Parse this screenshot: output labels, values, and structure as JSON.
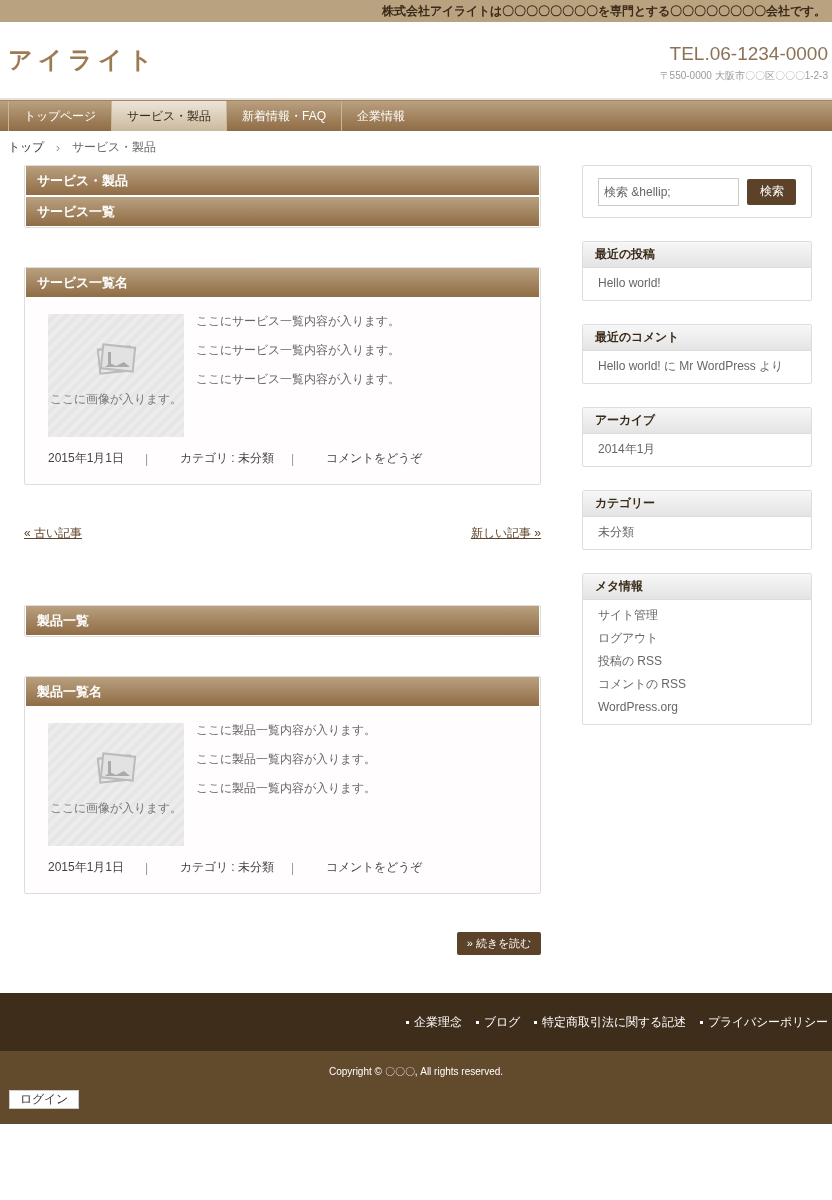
{
  "top_bar": {
    "text": "株式会社アイライトは〇〇〇〇〇〇〇〇を専門とする〇〇〇〇〇〇〇〇会社です。"
  },
  "header": {
    "logo": "アイライト",
    "tel": "TEL.06-1234-0000",
    "address": "〒550-0000 大阪市〇〇区〇〇〇1-2-3"
  },
  "nav": [
    {
      "label": "トップページ",
      "selected": false
    },
    {
      "label": "サービス・製品",
      "selected": true
    },
    {
      "label": "新着情報・FAQ",
      "selected": false
    },
    {
      "label": "企業情報",
      "selected": false
    }
  ],
  "breadcrumb": {
    "items": [
      "トップ",
      "サービス・製品"
    ],
    "separator": "›"
  },
  "services": {
    "headings": [
      "サービス・製品",
      "サービス一覧"
    ],
    "article": {
      "title": "サービス一覧名",
      "image_caption": "ここに画像が入ります。",
      "lines": [
        "ここにサービス一覧内容が入ります。",
        "ここにサービス一覧内容が入ります。",
        "ここにサービス一覧内容が入ります。"
      ],
      "date": "2015年1月1日",
      "separator": "|",
      "category": "カテゴリ : 未分類",
      "comment": "コメントをどうぞ"
    }
  },
  "pager": {
    "older": "« 古い記事",
    "newer": "新しい記事 »"
  },
  "products": {
    "headings": [
      "製品一覧"
    ],
    "article": {
      "title": "製品一覧名",
      "image_caption": "ここに画像が入ります。",
      "lines": [
        "ここに製品一覧内容が入ります。",
        "ここに製品一覧内容が入ります。",
        "ここに製品一覧内容が入ります。"
      ],
      "date": "2015年1月1日",
      "separator": "|",
      "category": "カテゴリ : 未分類",
      "comment": "コメントをどうぞ"
    }
  },
  "read_more": "» 続きを読む",
  "sidebar": {
    "search": {
      "placeholder": "検索 &hellip;",
      "button": "検索"
    },
    "widgets": [
      {
        "title": "最近の投稿",
        "items": [
          "Hello world!"
        ]
      },
      {
        "title": "最近のコメント",
        "items": [
          "Hello world! に Mr WordPress より"
        ]
      },
      {
        "title": "アーカイブ",
        "items": [
          "2014年1月"
        ]
      },
      {
        "title": "カテゴリー",
        "items": [
          "未分類"
        ]
      },
      {
        "title": "メタ情報",
        "items": [
          "サイト管理",
          "ログアウト",
          "投稿の RSS",
          "コメントの RSS",
          "WordPress.org"
        ]
      }
    ]
  },
  "footer": {
    "links": [
      "企業理念",
      "ブログ",
      "特定商取引法に関する記述",
      "プライバシーポリシー"
    ],
    "copyright": "Copyright © 〇〇〇, All rights reserved.",
    "login": "ログイン"
  }
}
